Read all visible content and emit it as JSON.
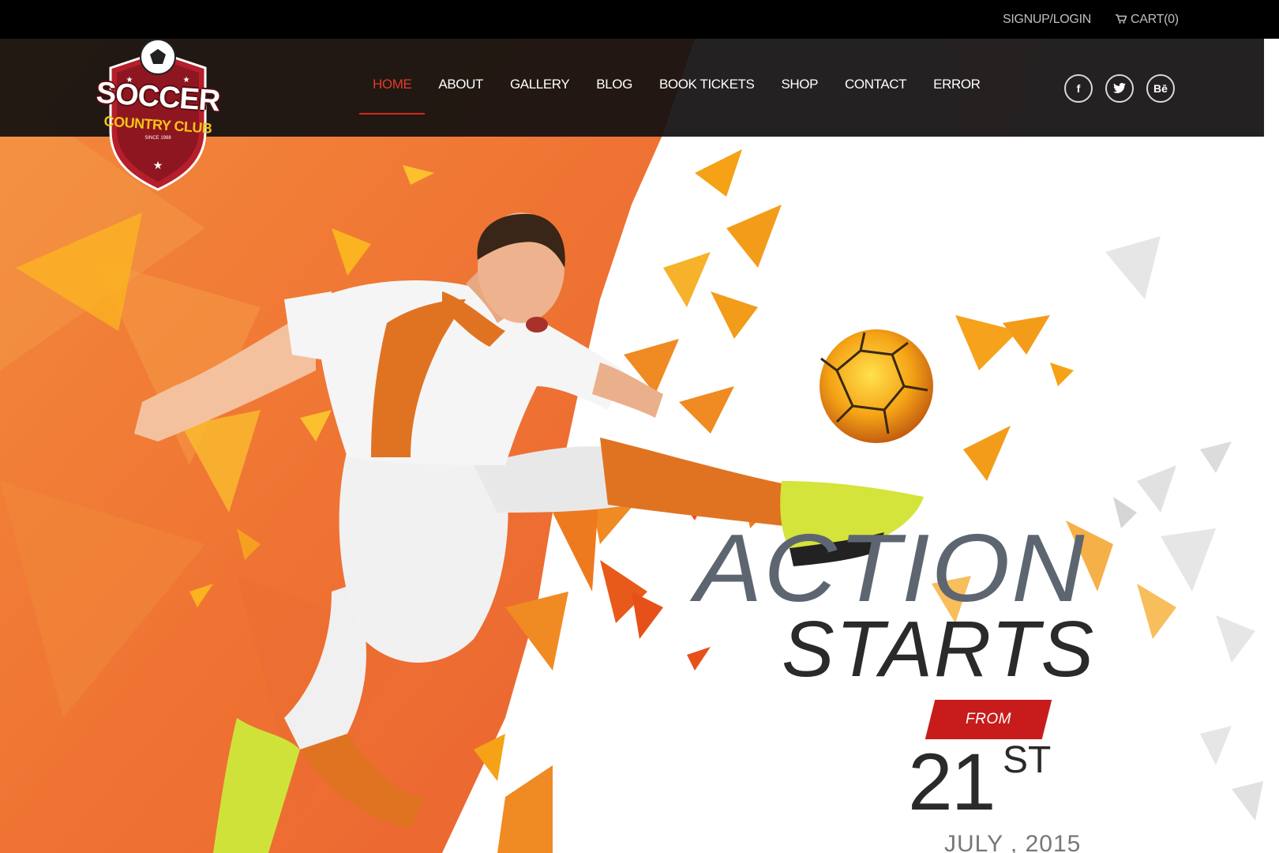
{
  "topbar": {
    "signup_login": "SIGNUP/LOGIN",
    "cart": "CART(0)",
    "cart_icon": "cart-icon"
  },
  "logo": {
    "title": "SOCCER",
    "subtitle": "COUNTRY CLUB",
    "since": "SINCE 1988"
  },
  "nav": {
    "items": [
      {
        "label": "HOME",
        "active": true
      },
      {
        "label": "ABOUT"
      },
      {
        "label": "GALLERY"
      },
      {
        "label": "BLOG"
      },
      {
        "label": "BOOK TICKETS"
      },
      {
        "label": "SHOP"
      },
      {
        "label": "CONTACT"
      },
      {
        "label": "ERROR"
      }
    ]
  },
  "social": {
    "facebook": "f",
    "twitter": "twitter-icon",
    "behance": "Bē"
  },
  "hero": {
    "line1": "ACTION",
    "line2": "STARTS",
    "from": "FROM",
    "day": "21",
    "day_suffix": "ST",
    "month_year": "JULY , 2015"
  },
  "colors": {
    "orange": "#f27a32",
    "accent_red": "#c81c1c",
    "nav_active": "#e23b2a",
    "dark": "#121010"
  }
}
